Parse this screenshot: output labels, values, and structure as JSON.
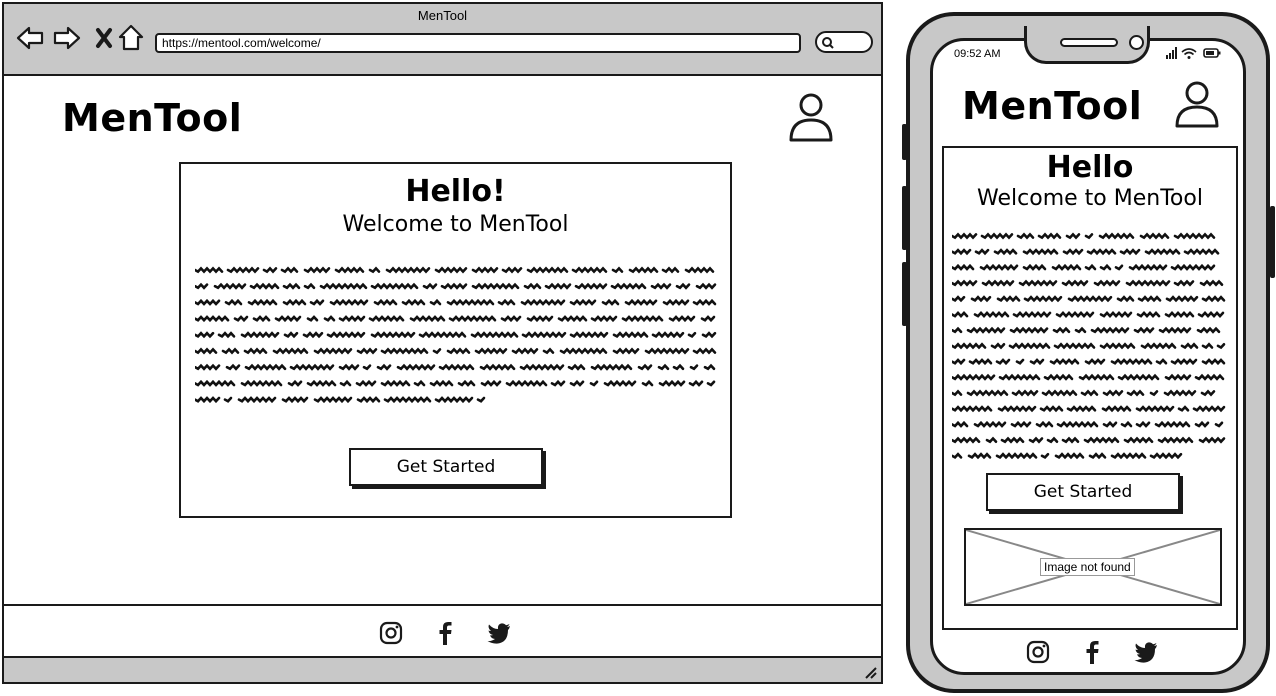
{
  "browser": {
    "window_title": "MenTool",
    "url": "https://mentool.com/welcome/",
    "nav": {
      "back_icon": "arrow-left-icon",
      "forward_icon": "arrow-right-icon",
      "stop_icon": "close-icon",
      "home_icon": "home-icon"
    },
    "search_icon": "search-icon"
  },
  "desktop": {
    "logo": "MenTool",
    "user_icon": "user-icon",
    "card": {
      "heading": "Hello!",
      "subheading": "Welcome to MenTool",
      "cta_label": "Get Started"
    },
    "footer": {
      "icons": [
        "instagram-icon",
        "facebook-icon",
        "twitter-icon"
      ]
    }
  },
  "mobile": {
    "time": "09:52 AM",
    "status_icons": [
      "signal-icon",
      "wifi-icon",
      "battery-icon"
    ],
    "logo": "MenTool",
    "user_icon": "user-icon",
    "card": {
      "heading": "Hello",
      "subheading": "Welcome to MenTool",
      "cta_label": "Get Started",
      "image_placeholder": "Image not found"
    },
    "footer": {
      "icons": [
        "instagram-icon",
        "facebook-icon",
        "twitter-icon"
      ]
    }
  },
  "colors": {
    "chrome": "#c8c8c8",
    "ink": "#1a1a1a",
    "background": "#ffffff"
  }
}
